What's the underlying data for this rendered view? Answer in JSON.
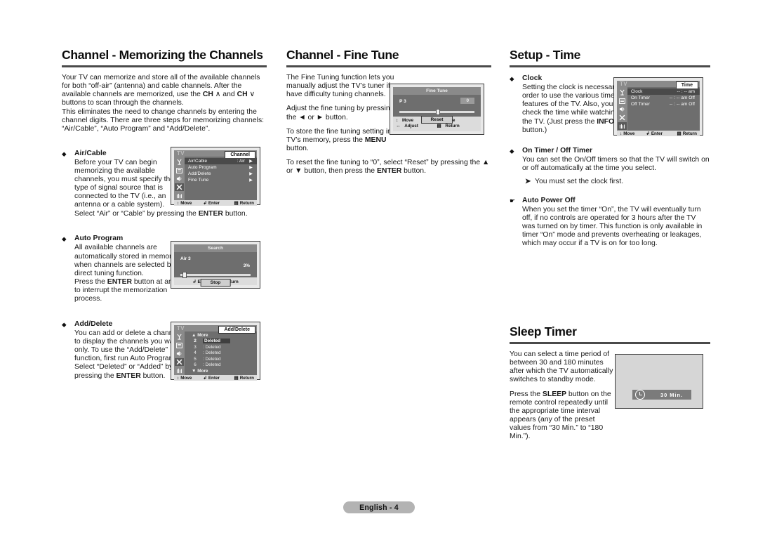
{
  "page": {
    "footer_label": "English - 4"
  },
  "columns": [
    {
      "title": "Channel - Memorizing the Channels",
      "intro": [
        "Your TV can memorize and store all of the available channels for both “off-air” (antenna) and cable channels. After the available channels are memorized, use the CH ∧ and CH ∨ buttons to scan through the channels.",
        "This eliminates the need to change channels by entering the channel digits. There are three steps for memorizing channels: “Air/Cable”, “Auto Program” and “Add/Delete”."
      ],
      "bullets": [
        {
          "marker": "◆",
          "heading": "Air/Cable",
          "lines": [
            "Before your TV can begin memorizing the available channels, you must specify the type of signal source that is connected to the TV (i.e., an antenna or a cable system).",
            "Select “Air” or “Cable” by pressing the ENTER button."
          ]
        },
        {
          "marker": "◆",
          "heading": "Auto Program",
          "lines": [
            "All available channels are automatically stored in memory when channels are selected by the direct tuning function.",
            "Press the ENTER button at any time to interrupt the memorization process."
          ]
        },
        {
          "marker": "◆",
          "heading": "Add/Delete",
          "lines": [
            "You can add or delete a channel to display the channels you want only. To use the “Add/Delete” function, first run Auto Program.",
            "Select “Deleted” or “Added” by pressing the ENTER button."
          ]
        }
      ]
    },
    {
      "title": "Channel - Fine Tune",
      "paragraphs": [
        "The Fine Tuning function lets you manually adjust the TV’s tuner if you have difficulty tuning channels.",
        "Adjust the fine tuning by pressing the ◄ or ► button.",
        "To store the fine tuning setting in the TV’s memory, press the MENU button.",
        "To reset the fine tuning to “0”, select “Reset” by pressing the ▲ or ▼ button, then press the ENTER button."
      ]
    },
    {
      "title": "Setup - Time",
      "bullets": [
        {
          "marker": "◆",
          "heading": "Clock",
          "lines": [
            "Setting the clock is necessary in order to use the various timer features of the TV. Also, you can check the time while watching the TV. (Just press the INFO button.)"
          ]
        },
        {
          "marker": "◆",
          "heading": "On Timer / Off Timer",
          "lines": [
            "You can set the On/Off timers so that the TV will switch on or off automatically at the time you select."
          ],
          "note": "You must set the clock first."
        },
        {
          "marker": "☛",
          "heading": "Auto Power Off",
          "lines": [
            "When you set the timer “On”, the TV will eventually turn off, if no controls are operated for 3 hours after the TV was turned on by timer. This function is only available in timer “On” mode and prevents overheating or leakages, which may occur if a TV is on for too long."
          ]
        }
      ],
      "sleep": {
        "title": "Sleep Timer",
        "paragraphs": [
          "You can select a time period of between 30 and 180 minutes after which the TV automatically switches to standby mode.",
          "Press the SLEEP button on the remote control repeatedly until the appropriate time interval appears (any of the preset values from “30 Min.” to “180 Min.”)."
        ],
        "osd_value": "30   Min."
      }
    }
  ],
  "osd": {
    "channel_menu": {
      "tv_label": "TV",
      "tag": "Channel",
      "rows": [
        {
          "label": "Air/Cable",
          "value": ": Air",
          "arrow": "▶",
          "selected": true
        },
        {
          "label": "Auto Program",
          "value": "",
          "arrow": "▶",
          "selected": false
        },
        {
          "label": "Add/Delete",
          "value": "",
          "arrow": "▶",
          "selected": false
        },
        {
          "label": "Fine Tune",
          "value": "",
          "arrow": "▶",
          "selected": false
        }
      ],
      "rail_icons": [
        "antenna-icon",
        "picture-icon",
        "speaker-icon",
        "channel-icon",
        "setup-icon"
      ],
      "selected_rail_index": 3,
      "footer": {
        "move": "Move",
        "enter": "Enter",
        "return": "Return"
      }
    },
    "search_dialog": {
      "title": "Search",
      "channel": "Air 3",
      "percent": "3%",
      "button": "Stop",
      "footer": {
        "enter": "Enter",
        "return": "Return"
      }
    },
    "adddelete_menu": {
      "tv_label": "TV",
      "tag": "Add/Delete",
      "more_up": "More",
      "more_down": "More",
      "rows": [
        {
          "num": "2",
          "status": "Deleted",
          "selected": true
        },
        {
          "num": "3",
          "status": ": Deleted",
          "selected": false
        },
        {
          "num": "4",
          "status": ": Deleted",
          "selected": false
        },
        {
          "num": "5",
          "status": ": Deleted",
          "selected": false
        },
        {
          "num": "6",
          "status": ": Deleted",
          "selected": false
        }
      ],
      "selected_rail_index": 3,
      "footer": {
        "move": "Move",
        "enter": "Enter",
        "return": "Return"
      }
    },
    "finetune_dialog": {
      "title": "Fine Tune",
      "channel": "P 3",
      "value": "0",
      "button": "Reset",
      "footer": {
        "move": "Move",
        "adjust": "Adjust",
        "save": "Save",
        "return": "Return"
      }
    },
    "time_menu": {
      "tv_label": "TV",
      "tag": "Time",
      "rows": [
        {
          "label": "Clock",
          "value": "-- : -- am",
          "selected": true
        },
        {
          "label": "On Timer",
          "value": "-- : -- am  Off",
          "selected": false
        },
        {
          "label": "Off Timer",
          "value": "-- : -- am  Off",
          "selected": false
        }
      ],
      "selected_rail_index": 4,
      "footer": {
        "move": "Move",
        "enter": "Enter",
        "return": "Return"
      }
    }
  }
}
